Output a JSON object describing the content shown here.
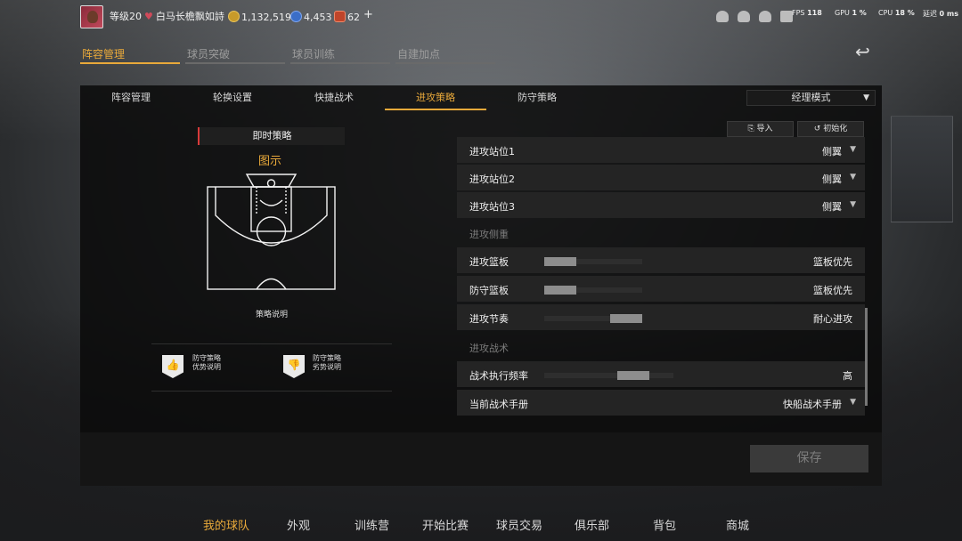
{
  "topbar": {
    "level": "等级20",
    "team_name": "白马长檐飘如詩",
    "gold": "1,132,519",
    "points": "4,453",
    "tickets": "62",
    "add": "+",
    "sys": {
      "fps_label": "FPS",
      "fps": "118",
      "gpu_label": "GPU",
      "gpu": "1 %",
      "cpu_label": "CPU",
      "cpu": "18 %",
      "latency_label": "延迟",
      "latency": "0 ms"
    }
  },
  "main_tabs": [
    "阵容管理",
    "球员突破",
    "球员训练",
    "自建加点"
  ],
  "sub_tabs": [
    "阵容管理",
    "轮换设置",
    "快捷战术",
    "进攻策略",
    "防守策略"
  ],
  "mode_select": "经理模式",
  "buttons": {
    "import": "导入",
    "reset": "初始化",
    "save": "保存"
  },
  "left": {
    "strategy_label": "即时策略",
    "diagram_title": "图示",
    "strategy_desc": "策略说明",
    "pro_title": "防守策略",
    "pro_sub": "优势说明",
    "con_title": "防守策略",
    "con_sub": "劣势说明"
  },
  "settings": {
    "positions": [
      {
        "label": "进攻站位1",
        "value": "侧翼"
      },
      {
        "label": "进攻站位2",
        "value": "侧翼"
      },
      {
        "label": "进攻站位3",
        "value": "侧翼"
      }
    ],
    "section_focus": "进攻侧重",
    "focus": [
      {
        "label": "进攻篮板",
        "value": "篮板优先",
        "level": 0.0
      },
      {
        "label": "防守篮板",
        "value": "篮板优先",
        "level": 0.0
      },
      {
        "label": "进攻节奏",
        "value": "耐心进攻",
        "level": 1.0
      }
    ],
    "section_tactics": "进攻战术",
    "frequency": {
      "label": "战术执行频率",
      "value": "高",
      "level": 0.75
    },
    "playbook": {
      "label": "当前战术手册",
      "value": "快船战术手册"
    }
  },
  "bottom_nav": [
    "我的球队",
    "外观",
    "训练营",
    "开始比赛",
    "球员交易",
    "俱乐部",
    "背包",
    "商城"
  ]
}
